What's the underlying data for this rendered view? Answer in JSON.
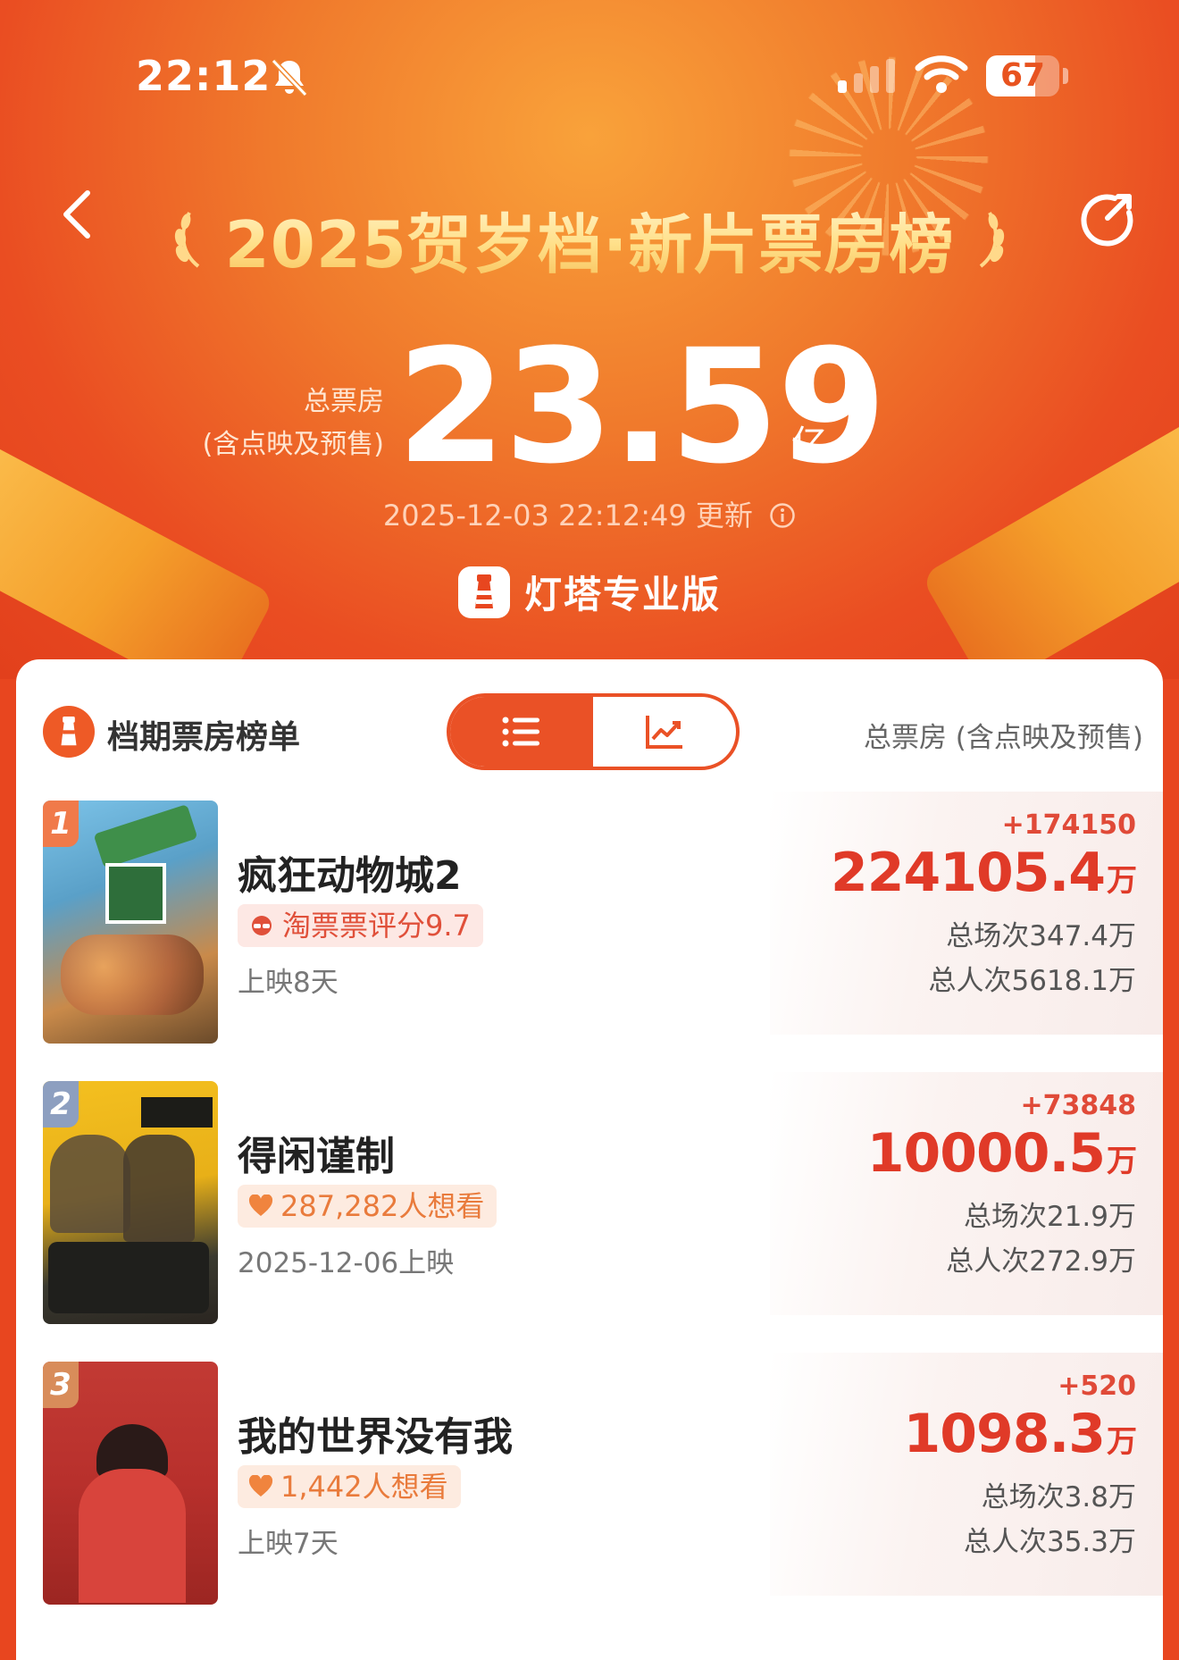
{
  "status_bar": {
    "time": "22:12",
    "battery": "67",
    "battery_level": 0.67
  },
  "header": {
    "title": "2025贺岁档·新片票房榜",
    "total_label_line1": "总票房",
    "total_label_line2": "(含点映及预售)",
    "total_value": "23.59",
    "total_unit": "亿",
    "update_time": "2025-12-03 22:12:49 更新",
    "brand": "灯塔专业版"
  },
  "card": {
    "title": "档期票房榜单",
    "right_label": "总票房 (含点映及预售)",
    "view_toggle": [
      "list-view",
      "chart-view"
    ],
    "active_view": "list-view"
  },
  "movies": [
    {
      "rank": "1",
      "title": "疯狂动物城2",
      "tag": "淘票票评分9.7",
      "tag_type": "rating",
      "sub": "上映8天",
      "delta": "+174150",
      "box_value": "224105.4",
      "box_unit": "万",
      "shows": "总场次347.4万",
      "viewers": "总人次5618.1万",
      "rank_color": "#f07a4a"
    },
    {
      "rank": "2",
      "title": "得闲谨制",
      "tag": "287,282人想看",
      "tag_type": "want",
      "sub": "2025-12-06上映",
      "delta": "+73848",
      "box_value": "10000.5",
      "box_unit": "万",
      "shows": "总场次21.9万",
      "viewers": "总人次272.9万",
      "rank_color": "#8d9fc0"
    },
    {
      "rank": "3",
      "title": "我的世界没有我",
      "tag": "1,442人想看",
      "tag_type": "want",
      "sub": "上映7天",
      "delta": "+520",
      "box_value": "1098.3",
      "box_unit": "万",
      "shows": "总场次3.8万",
      "viewers": "总人次35.3万",
      "rank_color": "#d88c5a"
    }
  ]
}
